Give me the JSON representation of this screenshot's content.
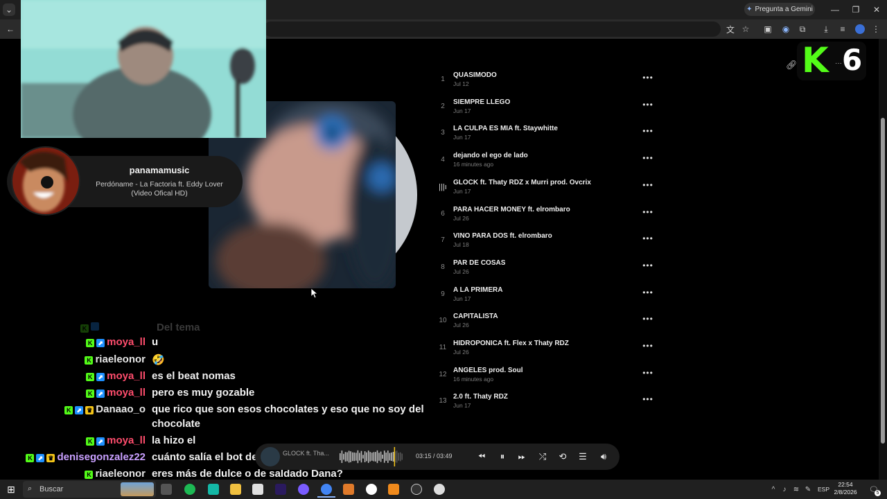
{
  "browser": {
    "gemini_label": "Pregunta a Gemini"
  },
  "now_playing": {
    "user": "panamamusic",
    "track_line1": "Perdóname - La Factoria ft. Eddy Lover",
    "track_line2": "(Video Ofical HD)"
  },
  "kick_badge": {
    "letter": "K",
    "number": "6"
  },
  "tracks": [
    {
      "num": "1",
      "title": "QUASIMODO",
      "date": "Jul 12"
    },
    {
      "num": "2",
      "title": "SIEMPRE LLEGO",
      "date": "Jun 17"
    },
    {
      "num": "3",
      "title": "LA CULPA ES MIA ft. Staywhitte",
      "date": "Jun 17"
    },
    {
      "num": "4",
      "title": "dejando el ego de lado",
      "date": "16 minutes ago"
    },
    {
      "num": "",
      "title": "GLOCK ft. Thaty RDZ x Murri prod. Ovcrix",
      "date": "Jun 17"
    },
    {
      "num": "6",
      "title": "PARA HACER MONEY ft. elrombaro",
      "date": "Jul 26"
    },
    {
      "num": "7",
      "title": "VINO PARA DOS ft. elrombaro",
      "date": "Jul 18"
    },
    {
      "num": "8",
      "title": "PAR DE COSAS",
      "date": "Jul 26"
    },
    {
      "num": "9",
      "title": "A LA PRIMERA",
      "date": "Jun 17"
    },
    {
      "num": "10",
      "title": "CAPITALISTA",
      "date": "Jul 26"
    },
    {
      "num": "11",
      "title": "HIDROPONICA ft. Flex x Thaty RDZ",
      "date": "Jul 26"
    },
    {
      "num": "12",
      "title": "ANGELES prod. Soul",
      "date": "16 minutes ago"
    },
    {
      "num": "13",
      "title": "2.0 ft. Thaty RDZ",
      "date": "Jun 17"
    }
  ],
  "chat": [
    {
      "user": "moya_ll",
      "color": "#ff4d6d",
      "badges": [
        "kick",
        "sub"
      ],
      "msg": "u"
    },
    {
      "user": "riaeleonor",
      "color": "#e6e6e6",
      "badges": [
        "kick"
      ],
      "msg": "🤣"
    },
    {
      "user": "moya_ll",
      "color": "#ff4d6d",
      "badges": [
        "kick",
        "sub"
      ],
      "msg": "es el beat nomas"
    },
    {
      "user": "moya_ll",
      "color": "#ff4d6d",
      "badges": [
        "kick",
        "sub"
      ],
      "msg": "pero es muy gozable"
    },
    {
      "user": "Danaao_o",
      "color": "#e6e6e6",
      "badges": [
        "kick",
        "sub",
        "crown"
      ],
      "msg": "que rico que son esos chocolates y eso que no soy del",
      "msg2": "chocolate"
    },
    {
      "user": "moya_ll",
      "color": "#ff4d6d",
      "badges": [
        "kick",
        "sub"
      ],
      "msg": "la hizo el"
    },
    {
      "user": "denisegonzalez22",
      "color": "#c9a0ff",
      "badges": [
        "kick",
        "sub",
        "crown"
      ],
      "msg": "cuánto salía el bot del otro día al final?"
    },
    {
      "user": "riaeleonor",
      "color": "#e6e6e6",
      "badges": [
        "kick"
      ],
      "msg": "eres más de dulce o de saldado Dana?"
    }
  ],
  "chat_faded": "Del tema",
  "player": {
    "title": "GLOCK ft. Tha...",
    "time": "03:15 / 03:49",
    "progress": 0.854
  },
  "taskbar": {
    "search_label": "Buscar",
    "lang": "ESP",
    "time": "22:54",
    "date": "2/8/2026",
    "notifications": "5"
  }
}
